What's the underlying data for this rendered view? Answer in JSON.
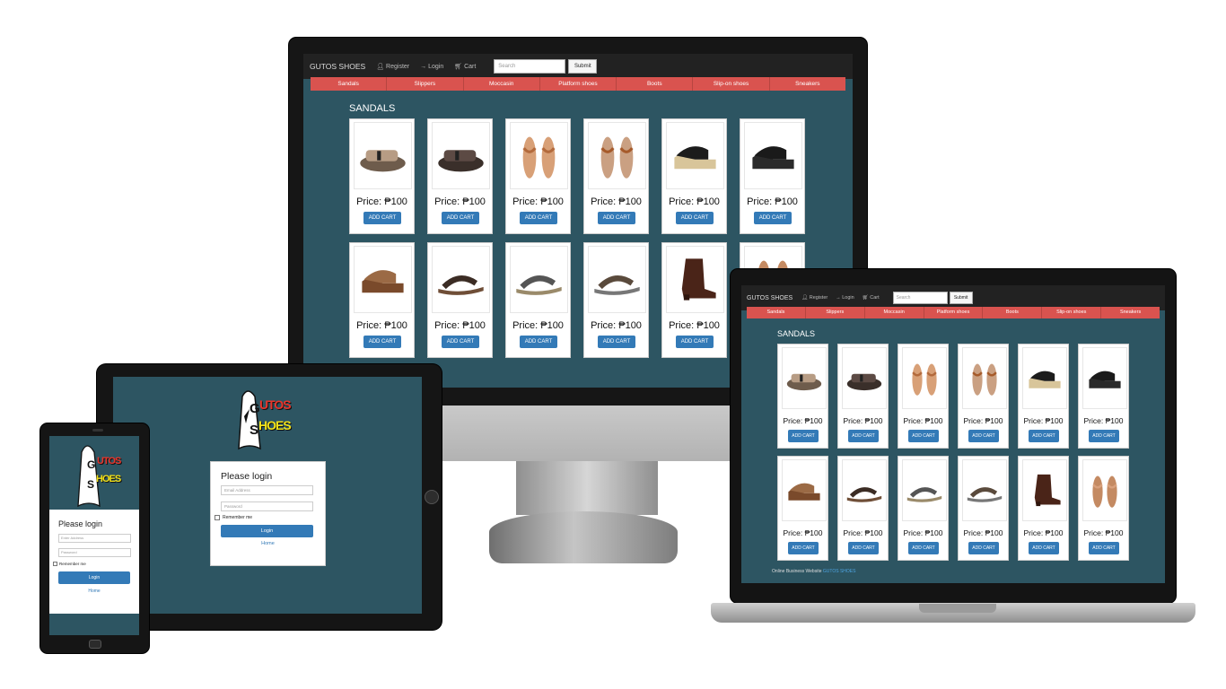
{
  "store": {
    "brand": "GUTOS SHOES",
    "nav": {
      "register": "Register",
      "login": "Login",
      "cart": "Cart"
    },
    "search_placeholder": "Search",
    "submit_label": "Submit",
    "categories": [
      "Sandals",
      "Slippers",
      "Moccasin",
      "Platform shoes",
      "Boots",
      "Slip-on shoes",
      "Sneakers"
    ],
    "section_title": "SANDALS",
    "price_label": "Price: ₱100",
    "add_cart_label": "ADD CART",
    "product_count": 12,
    "footer_text": "Online Business Website",
    "footer_link": "GUTOS SHOES"
  },
  "login": {
    "title": "Please login",
    "email_placeholder": "Email Address",
    "email_placeholder_phone": "Enter Address",
    "password_placeholder": "Password",
    "remember_label": "Remember me",
    "login_label": "Login",
    "home_label": "Home"
  },
  "logo": {
    "line1": "UTOS",
    "line2": "HOES"
  },
  "colors": {
    "page_bg": "#2d5562",
    "topbar": "#222222",
    "category_bar": "#d9534f",
    "button": "#337ab7",
    "link": "#4da3e0"
  },
  "icons": [
    "user-icon",
    "login-icon",
    "cart-icon"
  ]
}
